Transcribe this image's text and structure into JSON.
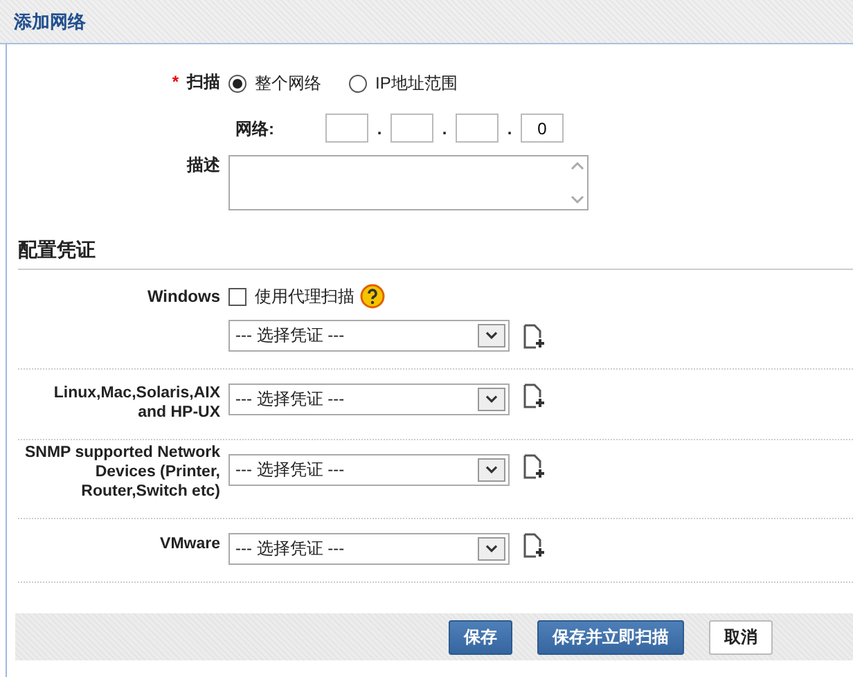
{
  "header": {
    "title": "添加网络"
  },
  "scan": {
    "required_mark": "*",
    "label": "扫描",
    "options": [
      {
        "label": "整个网络",
        "selected": true
      },
      {
        "label": "IP地址范围",
        "selected": false
      }
    ]
  },
  "network": {
    "label": "网络:",
    "octets": [
      {
        "kind": "empty"
      },
      {
        "kind": "empty"
      },
      {
        "kind": "empty"
      },
      {
        "kind": "filled",
        "value": "0"
      }
    ],
    "separators": [
      ".",
      ".",
      "."
    ]
  },
  "description": {
    "label": "描述"
  },
  "credentials": {
    "title": "配置凭证",
    "rows": [
      {
        "label": "Windows",
        "agent_scan": {
          "label": "使用代理扫描",
          "checked": false
        },
        "select": "--- 选择凭证 ---"
      },
      {
        "label": "Linux,Mac,Solaris,AIX and HP-UX",
        "select": "--- 选择凭证 ---"
      },
      {
        "label": "SNMP supported Network Devices (Printer, Router,Switch etc)",
        "select": "--- 选择凭证 ---"
      },
      {
        "label": "VMware",
        "select": "--- 选择凭证 ---"
      }
    ]
  },
  "buttons": [
    {
      "label": "保存",
      "kind": "primary"
    },
    {
      "label": "保存并立即扫描",
      "kind": "primary"
    },
    {
      "label": "取消",
      "kind": "secondary"
    }
  ]
}
